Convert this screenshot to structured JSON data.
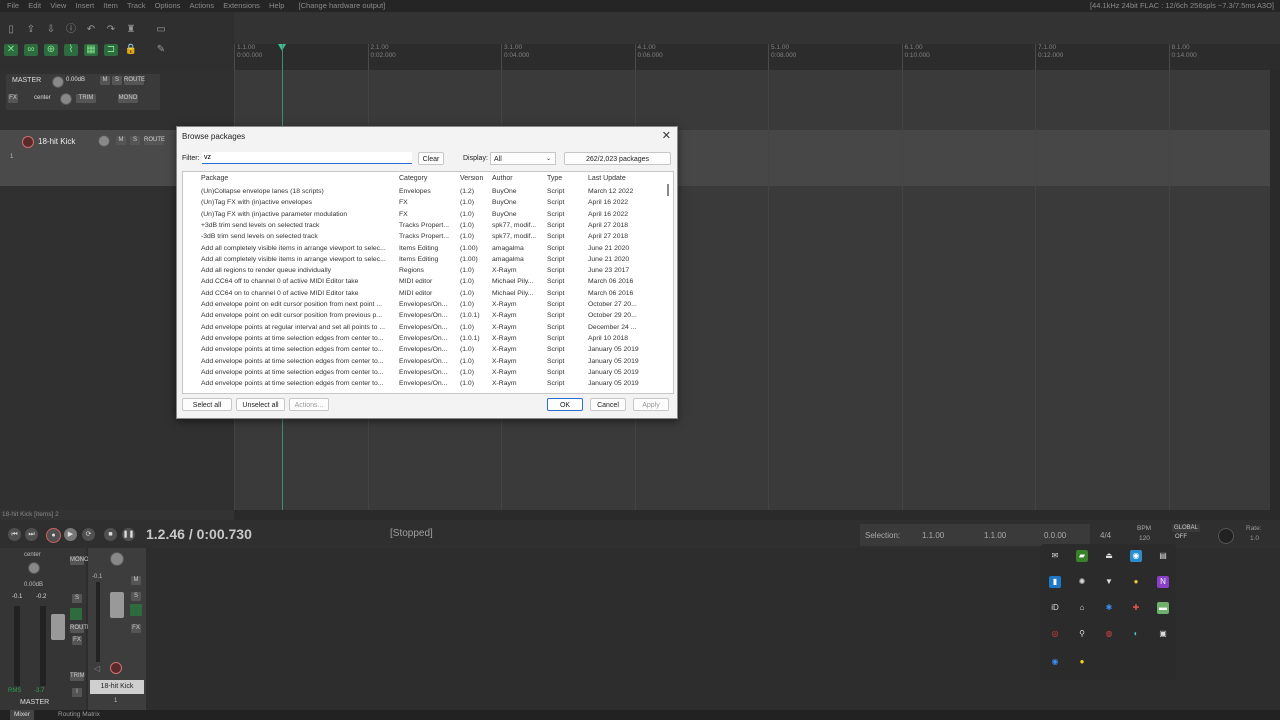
{
  "menubar": {
    "items": [
      "File",
      "Edit",
      "View",
      "Insert",
      "Item",
      "Track",
      "Options",
      "Actions",
      "Extensions",
      "Help"
    ],
    "hardware": "[Change hardware output]",
    "status": "[44.1kHz 24bit FLAC : 12/6ch 256spls ~7.3/7.5ms A3O]"
  },
  "ruler": {
    "ticks": [
      {
        "bar": "1.1.00",
        "time": "0:00.000"
      },
      {
        "bar": "2.1.00",
        "time": "0:02.000"
      },
      {
        "bar": "3.1.00",
        "time": "0:04.000"
      },
      {
        "bar": "4.1.00",
        "time": "0:06.000"
      },
      {
        "bar": "5.1.00",
        "time": "0:08.000"
      },
      {
        "bar": "6.1.00",
        "time": "0:10.000"
      },
      {
        "bar": "7.1.00",
        "time": "0:12.000"
      },
      {
        "bar": "8.1.00",
        "time": "0:14.000"
      }
    ]
  },
  "master_tcp": {
    "name": "MASTER",
    "volume": "0.00dB",
    "pan": "center",
    "mute": "M",
    "solo": "S",
    "route": "ROUTE",
    "fx": "FX",
    "trim": "TRIM",
    "mono": "MONO"
  },
  "track1": {
    "name": "18-hit Kick",
    "number": "1",
    "mute": "M",
    "solo": "S",
    "route": "ROUTE"
  },
  "status_line": "18-hit Kick [items] 2",
  "transport": {
    "time": "1.2.46 / 0:00.730",
    "state": "[Stopped]"
  },
  "selection": {
    "label": "Selection:",
    "start": "1.1.00",
    "end": "1.1.00",
    "length": "0.0.00",
    "timesig": "4/4",
    "bpm_label": "BPM",
    "bpm": "120",
    "global": "GLOBAL",
    "global_sub": "OFF",
    "rate_label": "Rate:",
    "rate": "1.0"
  },
  "mixer": {
    "master_label": "MASTER",
    "master_pan": "center",
    "master_vol": "0.00dB",
    "master_peak_l": "-0.1",
    "master_peak_r": "-0.2",
    "rms": "RMS",
    "rms_val": "-3.7",
    "track_name": "18-hit Kick",
    "track_num": "1",
    "track_peak": "-0.1",
    "mono": "MONO",
    "route": "ROUTE",
    "fx": "FX",
    "trim": "TRIM",
    "io": "I"
  },
  "bottom_tabs": [
    "Mixer",
    "Routing Matrix"
  ],
  "dialog": {
    "title": "Browse packages",
    "filter_label": "Filter:",
    "filter_value": "vz",
    "clear": "Clear",
    "display_label": "Display:",
    "display_value": "All",
    "package_count": "262/2,023 packages",
    "columns": [
      "Package",
      "Category",
      "Version",
      "Author",
      "Type",
      "Last Update"
    ],
    "rows": [
      [
        "(Un)Collapse envelope lanes (18 scripts)",
        "Envelopes",
        "(1.2)",
        "BuyOne",
        "Script",
        "March 12 2022"
      ],
      [
        "(Un)Tag FX with (in)active envelopes",
        "FX",
        "(1.0)",
        "BuyOne",
        "Script",
        "April 16 2022"
      ],
      [
        "(Un)Tag FX with (in)active parameter modulation",
        "FX",
        "(1.0)",
        "BuyOne",
        "Script",
        "April 16 2022"
      ],
      [
        "+3dB trim send levels on selected track",
        "Tracks Propert...",
        "(1.0)",
        "spk77, modif...",
        "Script",
        "April 27 2018"
      ],
      [
        "-3dB trim send levels on selected track",
        "Tracks Propert...",
        "(1.0)",
        "spk77, modif...",
        "Script",
        "April 27 2018"
      ],
      [
        "Add all completely visible items in arrange viewport to selec...",
        "Items Editing",
        "(1.00)",
        "amagalma",
        "Script",
        "June 21 2020"
      ],
      [
        "Add all completely visible items in arrange viewport to selec...",
        "Items Editing",
        "(1.00)",
        "amagalma",
        "Script",
        "June 21 2020"
      ],
      [
        "Add all regions to render queue individually",
        "Regions",
        "(1.0)",
        "X-Raym",
        "Script",
        "June 23 2017"
      ],
      [
        "Add CC64 off to channel 0 of active MIDI Editor take",
        "MIDI editor",
        "(1.0)",
        "Michael Pily...",
        "Script",
        "March 06 2016"
      ],
      [
        "Add CC64 on to channel 0 of active MIDI Editor take",
        "MIDI editor",
        "(1.0)",
        "Michael Pily...",
        "Script",
        "March 06 2016"
      ],
      [
        "Add envelope point on edit cursor position from next point ...",
        "Envelopes/On...",
        "(1.0)",
        "X-Raym",
        "Script",
        "October 27 20..."
      ],
      [
        "Add envelope point on edit cursor position from previous p...",
        "Envelopes/On...",
        "(1.0.1)",
        "X-Raym",
        "Script",
        "October 29 20..."
      ],
      [
        "Add envelope points at regular interval and set all points to ...",
        "Envelopes/On...",
        "(1.0)",
        "X-Raym",
        "Script",
        "December 24 ..."
      ],
      [
        "Add envelope points at time selection edges from center to...",
        "Envelopes/On...",
        "(1.0.1)",
        "X-Raym",
        "Script",
        "April 10 2018"
      ],
      [
        "Add envelope points at time selection edges from center to...",
        "Envelopes/On...",
        "(1.0)",
        "X-Raym",
        "Script",
        "January 05 2019"
      ],
      [
        "Add envelope points at time selection edges from center to...",
        "Envelopes/On...",
        "(1.0)",
        "X-Raym",
        "Script",
        "January 05 2019"
      ],
      [
        "Add envelope points at time selection edges from center to...",
        "Envelopes/On...",
        "(1.0)",
        "X-Raym",
        "Script",
        "January 05 2019"
      ],
      [
        "Add envelope points at time selection edges from center to...",
        "Envelopes/On...",
        "(1.0)",
        "X-Raym",
        "Script",
        "January 05 2019"
      ]
    ],
    "select_all": "Select all",
    "unselect_all": "Unselect all",
    "actions": "Actions...",
    "ok": "OK",
    "cancel": "Cancel",
    "apply": "Apply"
  },
  "tray_icons": [
    "mail-icon",
    "nvidia-icon",
    "app-icon",
    "app-icon",
    "calculator-icon",
    "app-icon",
    "app-icon",
    "vpn-icon",
    "app-icon",
    "app-icon",
    "id-icon",
    "usb-icon",
    "bluetooth-icon",
    "app-icon",
    "chat-icon",
    "app-icon",
    "app-icon",
    "app-icon",
    "app-icon",
    "display-icon",
    "app-icon",
    "app-icon"
  ],
  "tray_id_text": "iD"
}
